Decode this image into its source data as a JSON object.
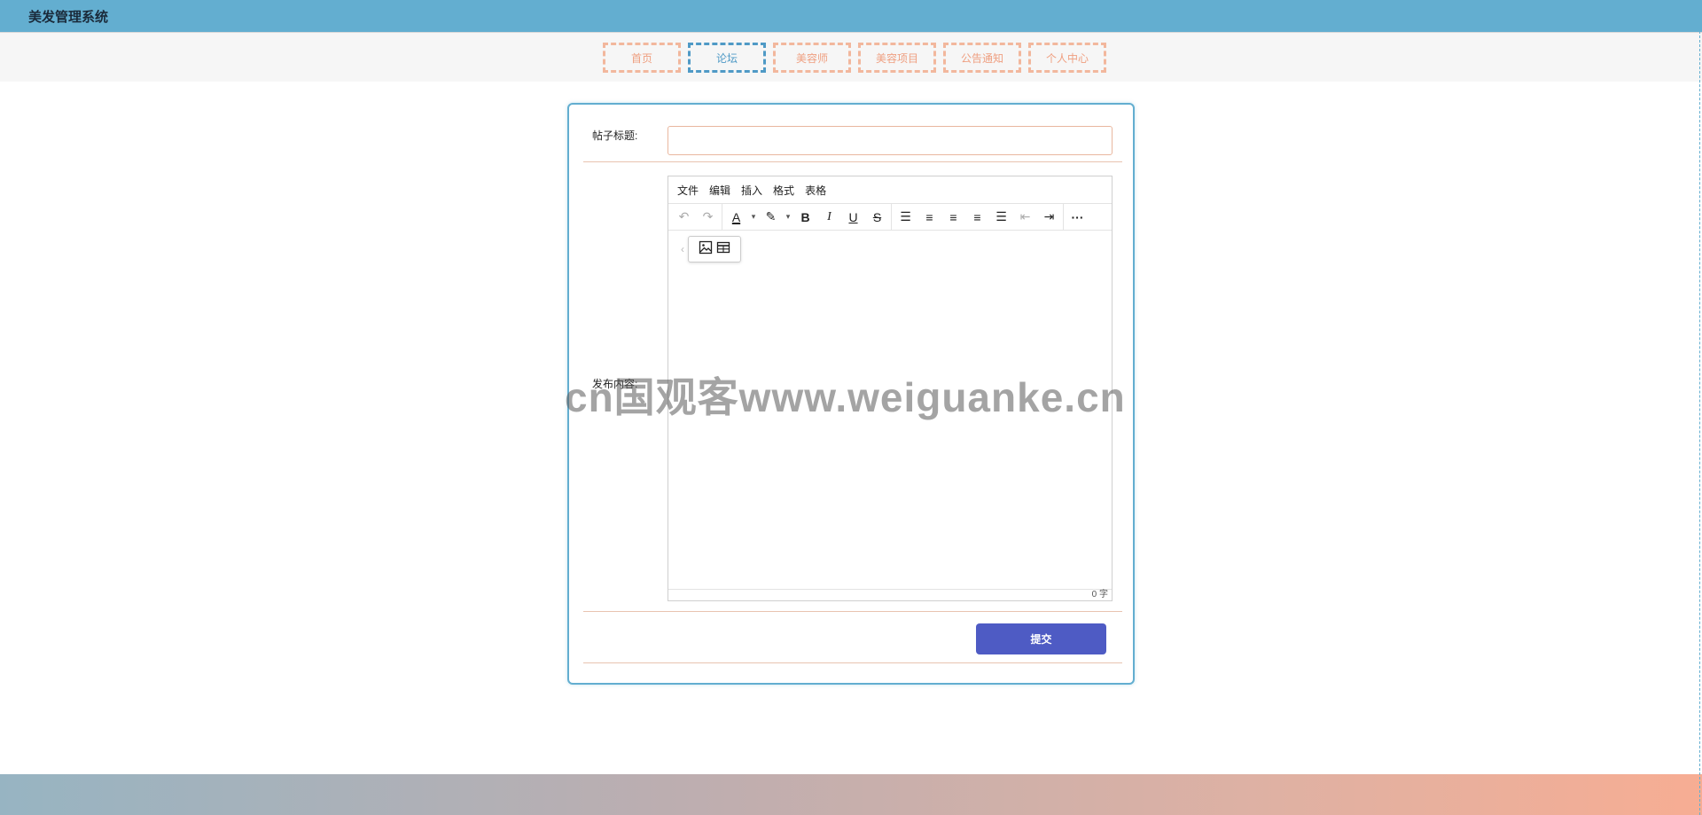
{
  "app": {
    "title": "美发管理系统"
  },
  "nav": {
    "items": [
      {
        "label": "首页",
        "active": false
      },
      {
        "label": "论坛",
        "active": true
      },
      {
        "label": "美容师",
        "active": false
      },
      {
        "label": "美容项目",
        "active": false
      },
      {
        "label": "公告通知",
        "active": false
      },
      {
        "label": "个人中心",
        "active": false
      }
    ]
  },
  "form": {
    "title_label": "帖子标题:",
    "title_value": "",
    "content_label": "发布内容:",
    "submit_label": "提交"
  },
  "editor": {
    "menus": [
      "文件",
      "编辑",
      "插入",
      "格式",
      "表格"
    ],
    "toolbar_icons": [
      "undo-icon",
      "redo-icon",
      "font-color-icon",
      "highlight-icon",
      "bold-icon",
      "italic-icon",
      "underline-icon",
      "strikethrough-icon",
      "line-height-icon",
      "align-left-icon",
      "align-center-icon",
      "align-right-icon",
      "align-justify-icon",
      "outdent-icon",
      "indent-icon",
      "more-icon"
    ],
    "quick_icons": [
      "image-icon",
      "table-icon"
    ],
    "word_count": "0 字"
  },
  "watermark": "cn国观客www.weiguanke.cn",
  "colors": {
    "header": "#63aed0",
    "accent_nav": "#f2b79d",
    "active_nav": "#4f9ac6",
    "submit": "#4e5bc4"
  }
}
